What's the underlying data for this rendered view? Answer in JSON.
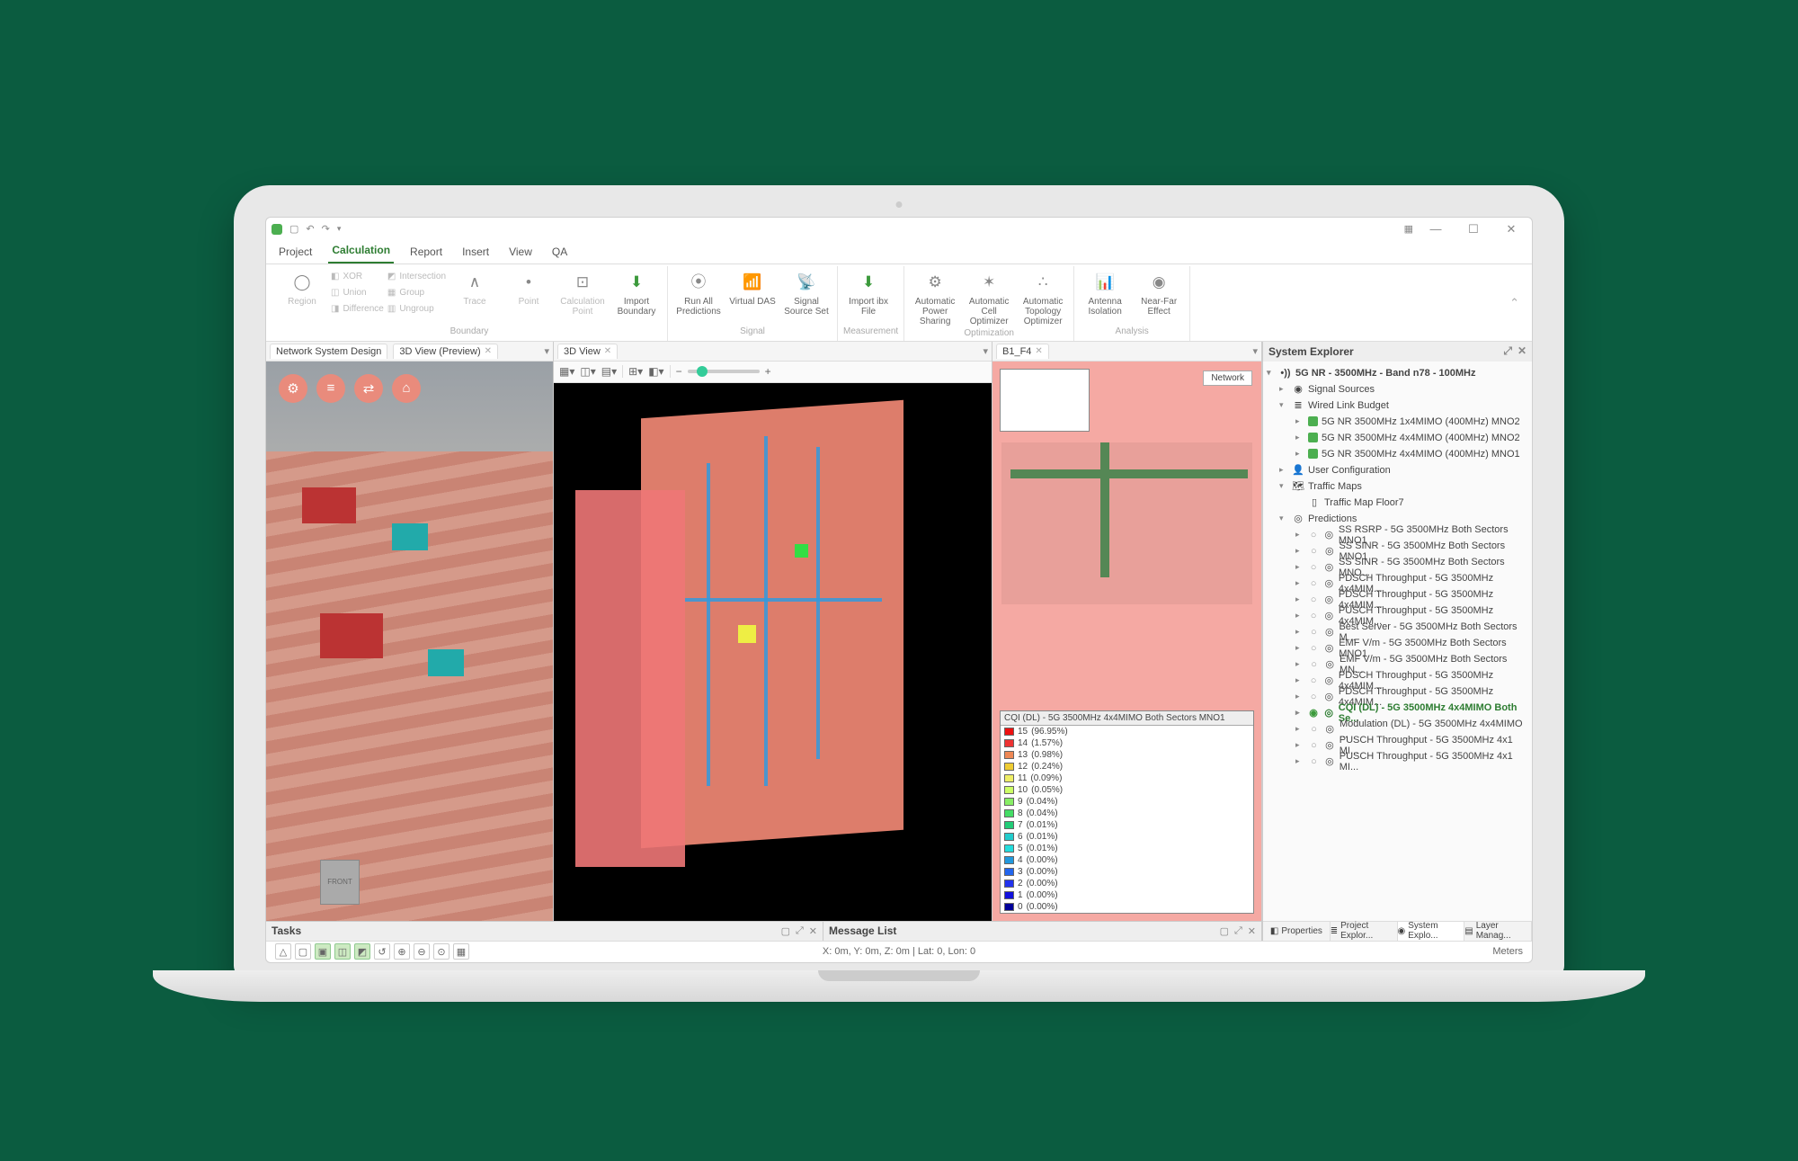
{
  "menu": {
    "tabs": [
      "Project",
      "Calculation",
      "Report",
      "Insert",
      "View",
      "QA"
    ],
    "active": "Calculation"
  },
  "ribbon": {
    "groups": [
      {
        "label": "Boundary",
        "items": [
          {
            "label": "Region",
            "dim": true
          },
          {
            "label": "XOR",
            "dim": true,
            "small": true
          },
          {
            "label": "Union",
            "dim": true,
            "small": true
          },
          {
            "label": "Difference",
            "dim": true,
            "small": true
          },
          {
            "label": "Intersection",
            "dim": true,
            "small": true
          },
          {
            "label": "Group",
            "dim": true,
            "small": true
          },
          {
            "label": "Ungroup",
            "dim": true,
            "small": true
          },
          {
            "label": "Trace",
            "dim": true
          },
          {
            "label": "Point",
            "dim": true
          },
          {
            "label": "Calculation Point",
            "dim": true
          },
          {
            "label": "Import Boundary"
          }
        ]
      },
      {
        "label": "Signal",
        "items": [
          {
            "label": "Run All Predictions"
          },
          {
            "label": "Virtual DAS"
          },
          {
            "label": "Signal Source Set"
          }
        ]
      },
      {
        "label": "Measurement",
        "items": [
          {
            "label": "Import ibx File"
          }
        ]
      },
      {
        "label": "Optimization",
        "items": [
          {
            "label": "Automatic Power Sharing"
          },
          {
            "label": "Automatic Cell Optimizer"
          },
          {
            "label": "Automatic Topology Optimizer"
          }
        ]
      },
      {
        "label": "Analysis",
        "items": [
          {
            "label": "Antenna Isolation"
          },
          {
            "label": "Near-Far Effect"
          }
        ]
      }
    ]
  },
  "docTabs": {
    "pane1": [
      {
        "label": "Network System Design"
      },
      {
        "label": "3D View (Preview)",
        "close": true
      }
    ],
    "pane2": [
      {
        "label": "3D View",
        "close": true
      }
    ],
    "pane3": [
      {
        "label": "B1_F4",
        "close": true
      }
    ]
  },
  "pane3": {
    "networkBtn": "Network"
  },
  "frontLabel": "FRONT",
  "legend": {
    "title": "CQI (DL) - 5G 3500MHz 4x4MIMO Both Sectors MNO1",
    "rows": [
      {
        "c": "#e11",
        "v": "15",
        "p": "(96.95%)"
      },
      {
        "c": "#e33",
        "v": "14",
        "p": "(1.57%)"
      },
      {
        "c": "#e85",
        "v": "13",
        "p": "(0.98%)"
      },
      {
        "c": "#ec3",
        "v": "12",
        "p": "(0.24%)"
      },
      {
        "c": "#ee6",
        "v": "11",
        "p": "(0.09%)"
      },
      {
        "c": "#cf6",
        "v": "10",
        "p": "(0.05%)"
      },
      {
        "c": "#8e6",
        "v": "9",
        "p": "(0.04%)"
      },
      {
        "c": "#4d6",
        "v": "8",
        "p": "(0.04%)"
      },
      {
        "c": "#2c7",
        "v": "7",
        "p": "(0.01%)"
      },
      {
        "c": "#2cc",
        "v": "6",
        "p": "(0.01%)"
      },
      {
        "c": "#2dd",
        "v": "5",
        "p": "(0.01%)"
      },
      {
        "c": "#29d",
        "v": "4",
        "p": "(0.00%)"
      },
      {
        "c": "#26e",
        "v": "3",
        "p": "(0.00%)"
      },
      {
        "c": "#23e",
        "v": "2",
        "p": "(0.00%)"
      },
      {
        "c": "#11d",
        "v": "1",
        "p": "(0.00%)"
      },
      {
        "c": "#009",
        "v": "0",
        "p": "(0.00%)"
      }
    ]
  },
  "explorer": {
    "title": "System Explorer",
    "root": "5G NR - 3500MHz - Band n78 - 100MHz",
    "signalSources": "Signal Sources",
    "wiredLink": "Wired Link Budget",
    "links": [
      "5G NR 3500MHz 1x4MIMO (400MHz) MNO2",
      "5G NR 3500MHz 4x4MIMO (400MHz) MNO2",
      "5G NR 3500MHz 4x4MIMO (400MHz) MNO1"
    ],
    "userConfig": "User Configuration",
    "trafficMaps": "Traffic Maps",
    "trafficItem": "Traffic Map Floor7",
    "predictions": "Predictions",
    "preds": [
      "SS RSRP - 5G 3500MHz Both Sectors MNO1",
      "SS SINR - 5G 3500MHz Both Sectors MNO1",
      "SS SINR - 5G 3500MHz Both Sectors MNO...",
      "PDSCH Throughput - 5G 3500MHz 4x4MIM...",
      "PDSCH Throughput - 5G 3500MHz 4x4MIM...",
      "PUSCH Throughput - 5G 3500MHz 4x4MIM...",
      "Best Server - 5G 3500MHz Both Sectors M...",
      "EMF V/m - 5G 3500MHz Both Sectors MNO1",
      "EMF V/m - 5G 3500MHz Both Sectors MN...",
      "PDSCH Throughput - 5G 3500MHz 4x4MIM...",
      "PDSCH Throughput - 5G 3500MHz 4x4MIM...",
      "CQI (DL) - 5G 3500MHz 4x4MIMO Both Se...",
      "Modulation (DL) - 5G 3500MHz 4x4MIMO ...",
      "PUSCH Throughput - 5G 3500MHz 4x1 MI...",
      "PUSCH Throughput - 5G 3500MHz 4x1 MI..."
    ],
    "sel": 11,
    "bottomTabs": [
      "Properties",
      "Project Explor...",
      "System Explo...",
      "Layer Manag..."
    ]
  },
  "bottom": {
    "tasks": "Tasks",
    "messages": "Message List"
  },
  "status": {
    "coords": "X: 0m, Y: 0m, Z: 0m | Lat: 0, Lon: 0",
    "units": "Meters"
  }
}
